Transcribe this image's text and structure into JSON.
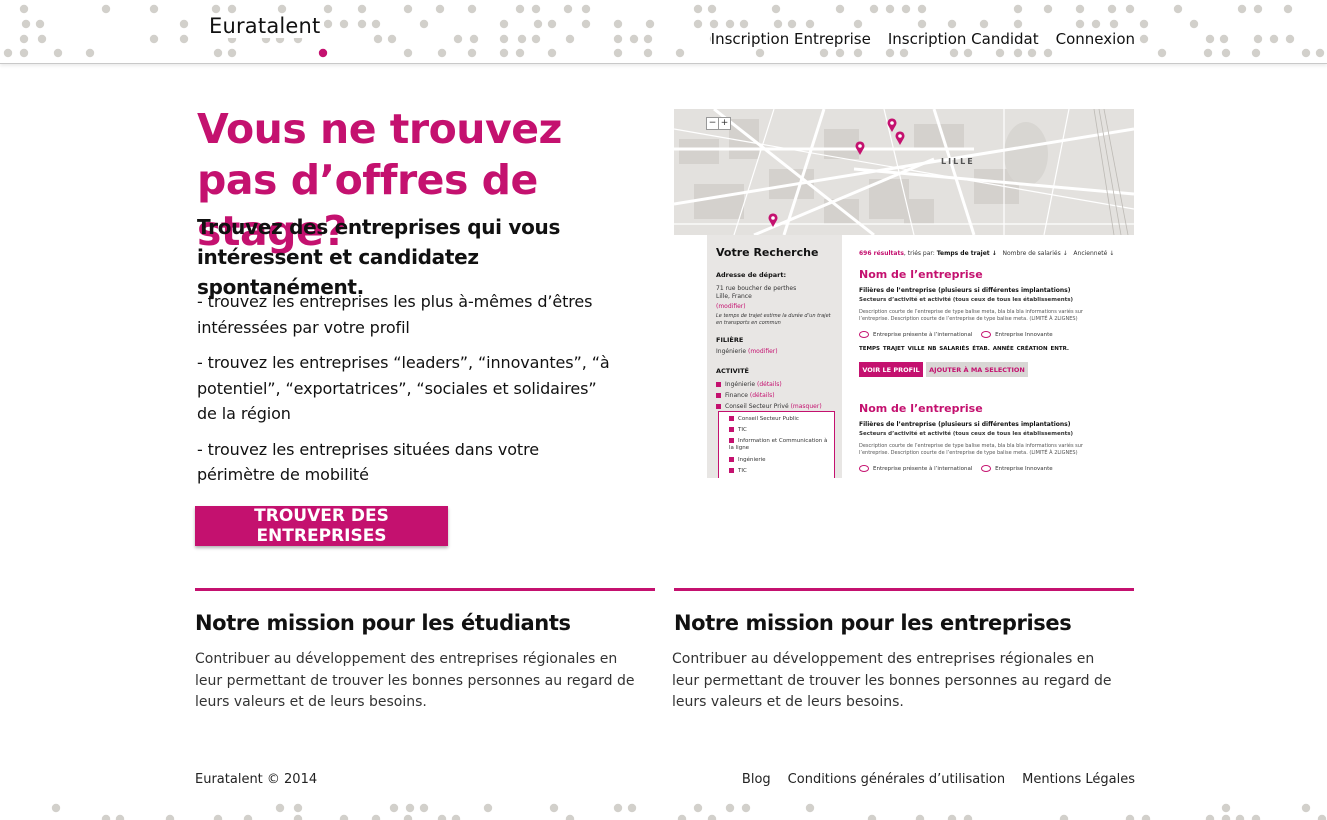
{
  "header": {
    "brand": "Euratalent",
    "nav": [
      {
        "label": "Inscription Entreprise"
      },
      {
        "label": "Inscription Candidat"
      },
      {
        "label": "Connexion"
      }
    ]
  },
  "hero": {
    "title": "Vous ne trouvez pas d’offres de stage?",
    "subtitle": "Trouvez des entreprises qui vous intéressent et candidatez spontanément.",
    "bullets": [
      "- trouvez les entreprises les plus à-mêmes d’êtres intéressées par votre profil",
      "- trouvez les entreprises “leaders”, “innovantes”, “à potentiel”, “exportatrices”, “sociales et solidaires” de la région",
      "- trouvez les entreprises situées dans votre périmètre de mobilité"
    ],
    "cta": "TROUVER DES ENTREPRISES"
  },
  "preview": {
    "map_city": "LILLE",
    "zoom_out": "−",
    "zoom_in": "+",
    "sidebar": {
      "title": "Votre Recherche",
      "address_label": "Adresse de départ:",
      "address_line1": "71 rue boucher de perthes",
      "address_line2": "Lille, France",
      "modify": "(modifier)",
      "note": "Le temps de trajet estime la durée d’un trajet en transports en commun",
      "filiere_label": "FILIÈRE",
      "filiere_value": "Ingénierie",
      "activite_label": "ACTIVITÉ",
      "activities": [
        {
          "label": "Ingénierie",
          "link": "(détails)"
        },
        {
          "label": "Finance",
          "link": "(détails)"
        },
        {
          "label": "Conseil Secteur Privé",
          "link": "(masquer)"
        }
      ],
      "sub_activities": [
        "Conseil Secteur Public",
        "TIC",
        "Information et Communication à la ligne",
        "Ingénierie",
        "TIC"
      ]
    },
    "results": {
      "count": "696 résultats",
      "sort_prefix": ", triés par:",
      "sort_options": [
        "Temps de trajet ↓",
        "Nombre de salariés ↓",
        "Ancienneté ↓"
      ],
      "cards": [
        {
          "name": "Nom de l’entreprise",
          "filieres": "Filières de l’entreprise (plusieurs si différentes implantations)",
          "secteurs": "Secteurs d’activité et activité (tous ceux de tous les établissements)",
          "description": "Description courte de l’entreprise de type balise meta, bla bla bla informations variés sur l’entreprise. Description courte de l’entreprise de type balise meta. (LIMITÉ À 2LIGNES)",
          "label_intl": "Entreprise présente à l’international",
          "label_innov": "Entreprise Innovante"
        },
        {
          "name": "Nom de l’entreprise",
          "filieres": "Filières de l’entreprise (plusieurs si différentes implantations)",
          "secteurs": "Secteurs d’activité et activité (tous ceux de tous les établissements)",
          "description": "Description courte de l’entreprise de type balise meta, bla bla bla informations variés sur l’entreprise. Description courte de l’entreprise de type balise meta. (LIMITÉ À 2LIGNES)",
          "label_intl": "Entreprise présente à l’international",
          "label_innov": "Entreprise Innovante"
        }
      ],
      "columns": "TEMPS TRAJET    VILLE    NB SALARIÉS ÉTAB.    ANNÉE CRÉATION ENTR.",
      "btn_profile": "VOIR LE PROFIL",
      "btn_select": "AJOUTER À MA SELECTION"
    }
  },
  "missions": [
    {
      "title": "Notre mission pour les étudiants",
      "text": "Contribuer au développement des entreprises régionales en leur permettant de trouver les bonnes personnes au regard de leurs valeurs et de leurs besoins."
    },
    {
      "title": "Notre mission pour les entreprises",
      "text": "Contribuer au développement des entreprises régionales en leur permettant de trouver les bonnes personnes au regard de leurs valeurs et de leurs besoins."
    }
  ],
  "footer": {
    "copyright": "Euratalent © 2014",
    "links": [
      {
        "label": "Blog"
      },
      {
        "label": "Conditions générales d’utilisation"
      },
      {
        "label": "Mentions Légales"
      }
    ]
  },
  "colors": {
    "accent": "#c4116f",
    "dots": "#d2d0cb",
    "map_bg": "#e6e4e2",
    "sidebar_bg": "#e8e6e4"
  }
}
